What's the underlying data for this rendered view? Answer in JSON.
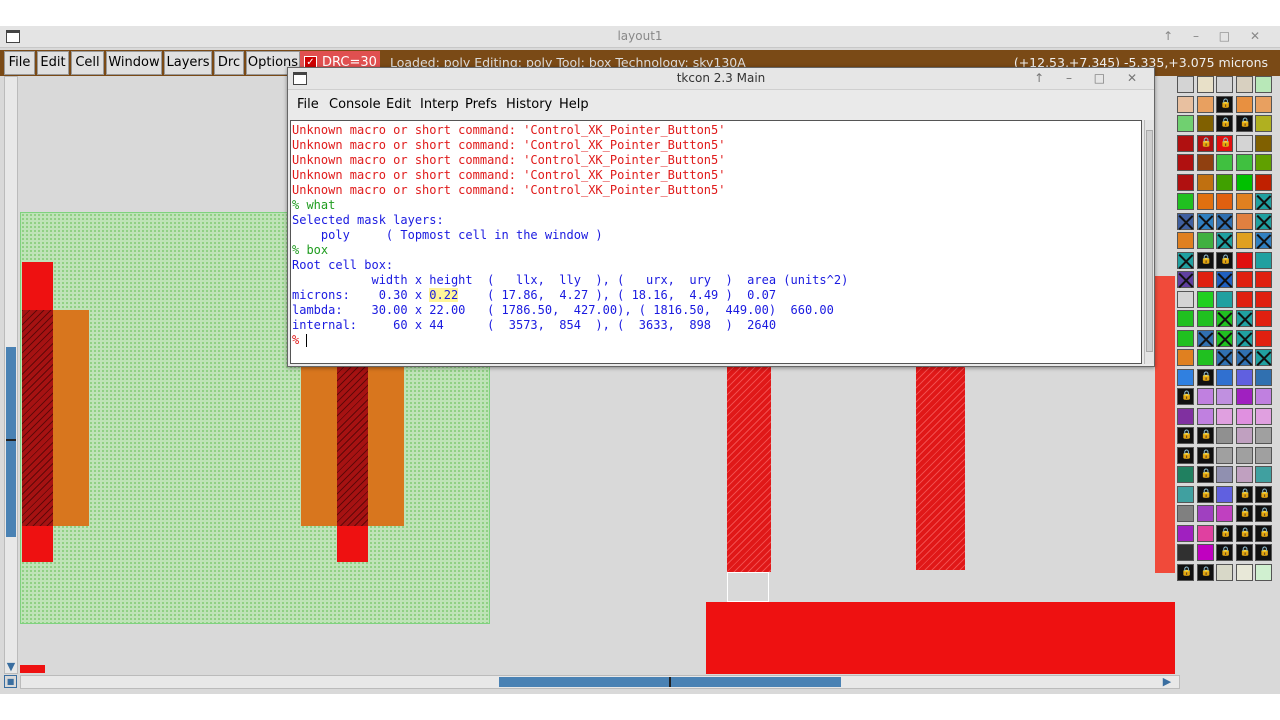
{
  "magic": {
    "title": "layout1",
    "menu": [
      "File",
      "Edit",
      "Cell",
      "Window",
      "Layers",
      "Drc",
      "Options"
    ],
    "drc_label": "DRC=30",
    "status": "Loaded: poly Editing: poly Tool: box Technology: sky130A",
    "coords": "(+12.53,+7.345) -5.335,+3.075 microns"
  },
  "tkcon": {
    "title": "tkcon 2.3 Main",
    "menu": [
      "File",
      "Console",
      "Edit",
      "Interp",
      "Prefs",
      "History",
      "Help"
    ],
    "lines": [
      {
        "cls": "l-red",
        "text": "Unknown macro or short command: 'Control_XK_Pointer_Button5'"
      },
      {
        "cls": "l-red",
        "text": "Unknown macro or short command: 'Control_XK_Pointer_Button5'"
      },
      {
        "cls": "l-red",
        "text": "Unknown macro or short command: 'Control_XK_Pointer_Button5'"
      },
      {
        "cls": "l-red",
        "text": "Unknown macro or short command: 'Control_XK_Pointer_Button5'"
      },
      {
        "cls": "l-red",
        "text": "Unknown macro or short command: 'Control_XK_Pointer_Button5'"
      },
      {
        "cls": "l-green",
        "text": "% what"
      },
      {
        "cls": "l-blue",
        "text": "Selected mask layers:"
      },
      {
        "cls": "l-blue",
        "text": "    poly     ( Topmost cell in the window )"
      },
      {
        "cls": "l-green",
        "text": "% box"
      },
      {
        "cls": "l-blue",
        "text": "Root cell box:"
      },
      {
        "cls": "l-blue",
        "text": "           width x height  (   llx,  lly  ), (   urx,  ury  )  area (units^2)"
      },
      {
        "cls": "l-blue",
        "text": ""
      },
      {
        "cls": "l-blue",
        "text": "microns:    0.30 x ",
        "hl": "0.22",
        "rest": "    ( 17.86,  4.27 ), ( 18.16,  4.49 )  0.07"
      },
      {
        "cls": "l-blue",
        "text": "lambda:    30.00 x 22.00   ( 1786.50,  427.00), ( 1816.50,  449.00)  660.00"
      },
      {
        "cls": "l-blue",
        "text": "internal:     60 x 44      (  3573,  854  ), (  3633,  898  )  2640"
      }
    ],
    "prompt": "% "
  },
  "colors": {
    "menubar_bg": "#7a4a16",
    "poly": "#ee1111",
    "ndiff": "#bfe3b8",
    "locali": "#d8761e",
    "scroll": "#4a82b4"
  }
}
